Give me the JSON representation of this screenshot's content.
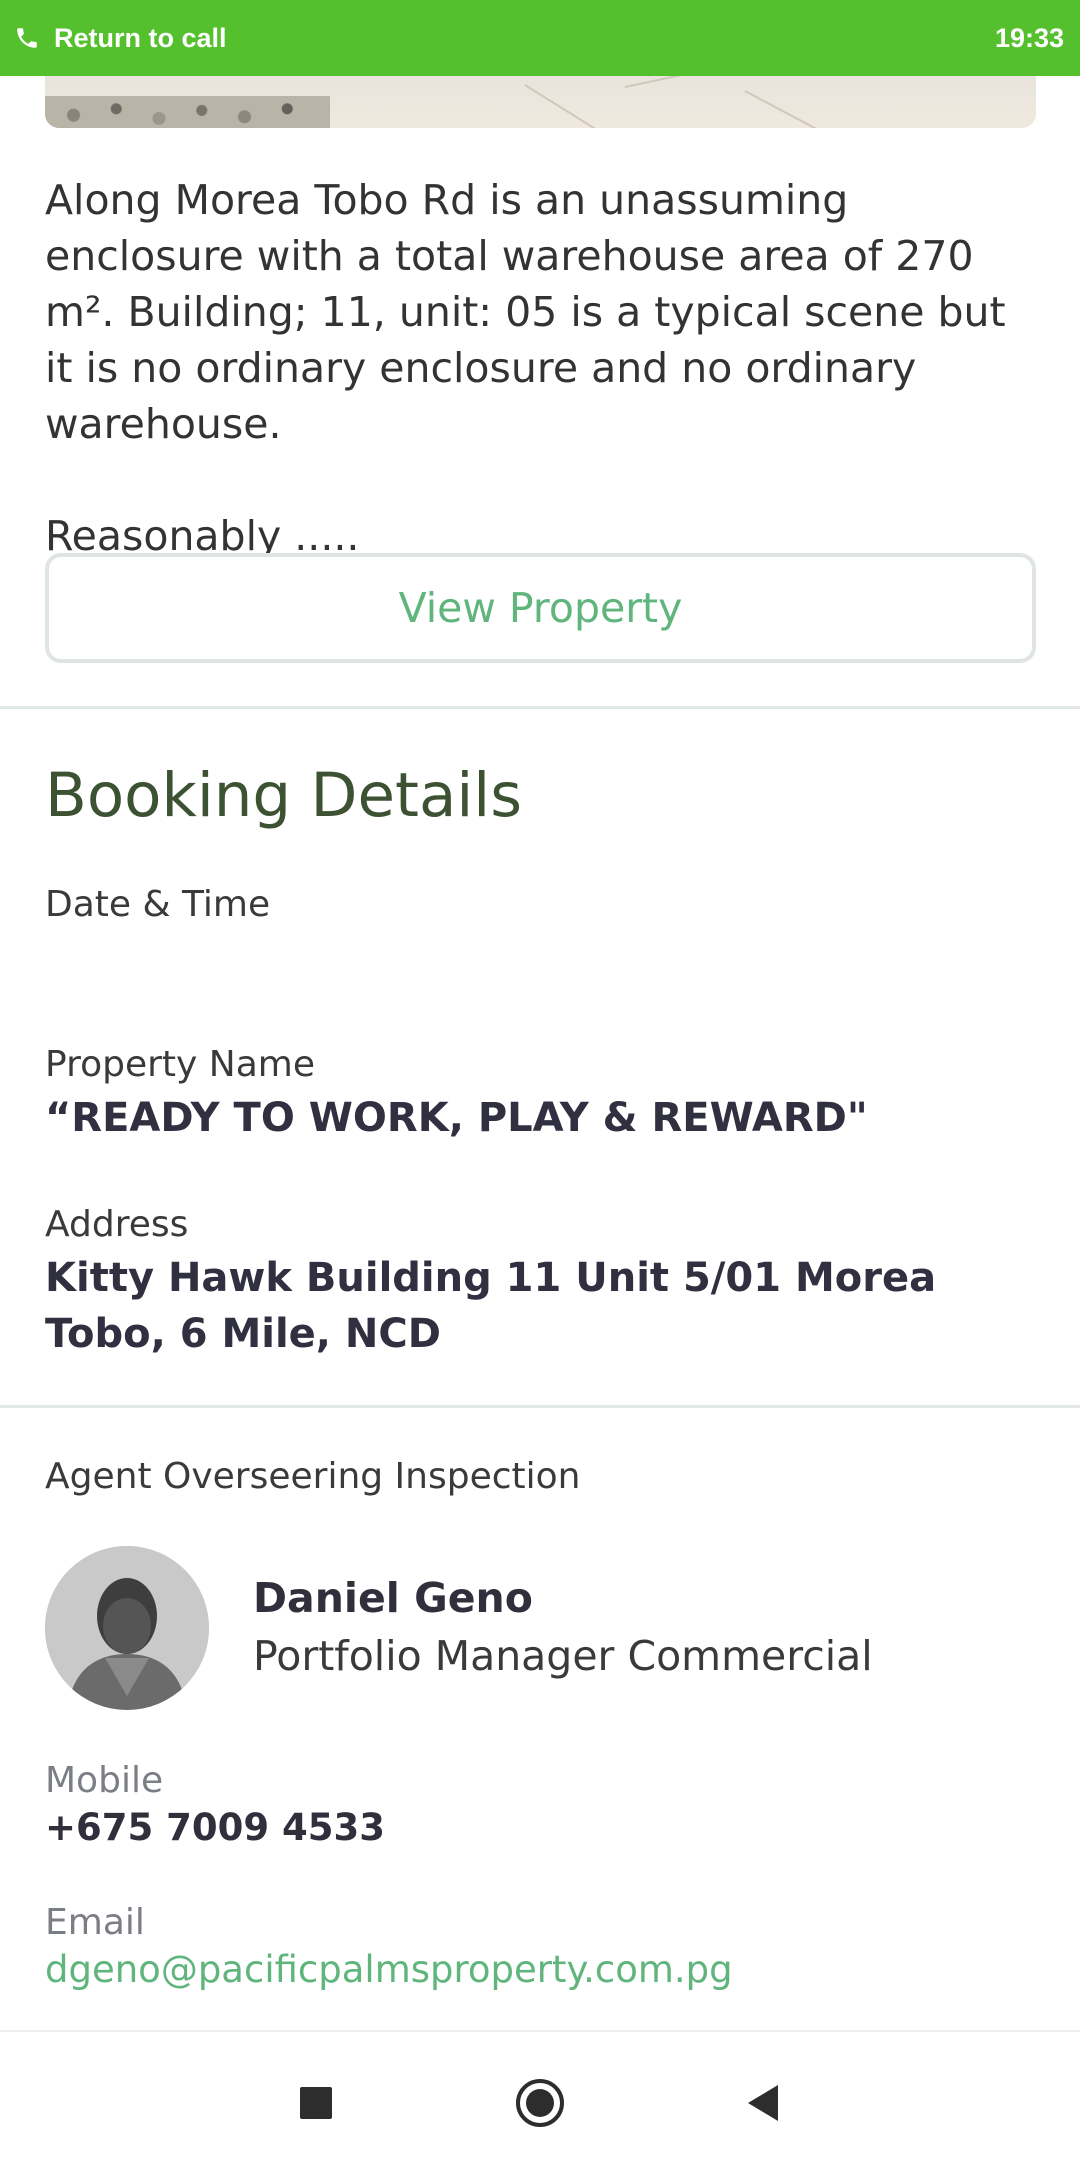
{
  "status_bar": {
    "return_label": "Return to call",
    "time": "19:33",
    "color": "#55c02d"
  },
  "property": {
    "description": "Along Morea Tobo Rd is an unassuming enclosure with a total warehouse area of 270 m². Building; 11, unit: 05 is a typical scene but it is no ordinary enclosure and no ordinary warehouse.\n\nReasonably .....",
    "view_button_label": "View Property"
  },
  "booking": {
    "title": "Booking Details",
    "date_time_label": "Date & Time",
    "date_time_value": "",
    "property_name_label": "Property Name",
    "property_name_value": "“READY TO WORK, PLAY & REWARD\"",
    "address_label": "Address",
    "address_value": "Kitty Hawk Building 11 Unit 5/01 Morea Tobo, 6 Mile, NCD"
  },
  "agent": {
    "section_label": "Agent Overseering Inspection",
    "name": "Daniel Geno",
    "title": "Portfolio Manager Commercial",
    "mobile_label": "Mobile",
    "mobile_value": "+675 7009 4533",
    "email_label": "Email",
    "email_value": "dgeno@pacificpalmsproperty.com.pg"
  },
  "nav": {
    "icons": [
      "recents-square-icon",
      "home-circle-icon",
      "back-triangle-icon"
    ]
  },
  "colors": {
    "accent_green": "#5fb57c",
    "title_green": "#3c5233"
  }
}
